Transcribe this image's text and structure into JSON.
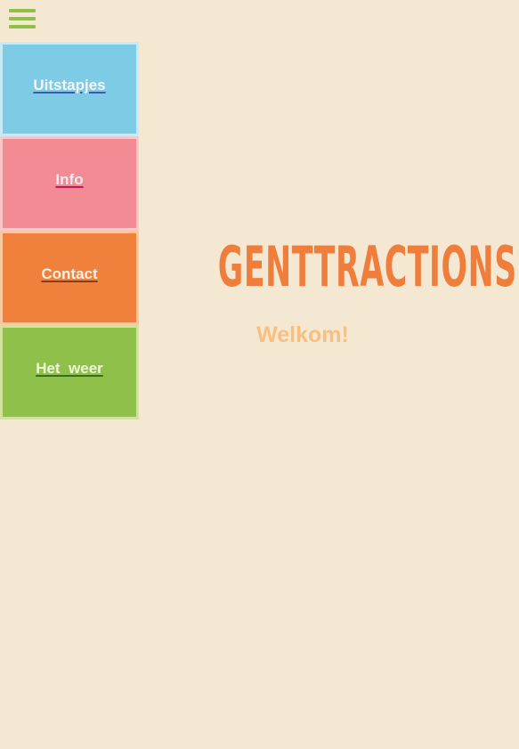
{
  "header": {
    "menu_icon": "hamburger-menu-icon"
  },
  "nav": {
    "items": [
      {
        "label": "Uitstapjes",
        "color": "#7ecbe6"
      },
      {
        "label": "Info",
        "color": "#f28b94"
      },
      {
        "label": "Contact",
        "color": "#f0813c"
      },
      {
        "label": "Het  weer",
        "color": "#8fc04a"
      }
    ]
  },
  "main": {
    "title": "GENTTRACTIONS",
    "subtitle": "Welkom!"
  },
  "colors": {
    "background": "#f5e8d3",
    "title": "#ef7e3c",
    "subtitle": "#f9bf80",
    "hamburger": "#8fc04a"
  }
}
